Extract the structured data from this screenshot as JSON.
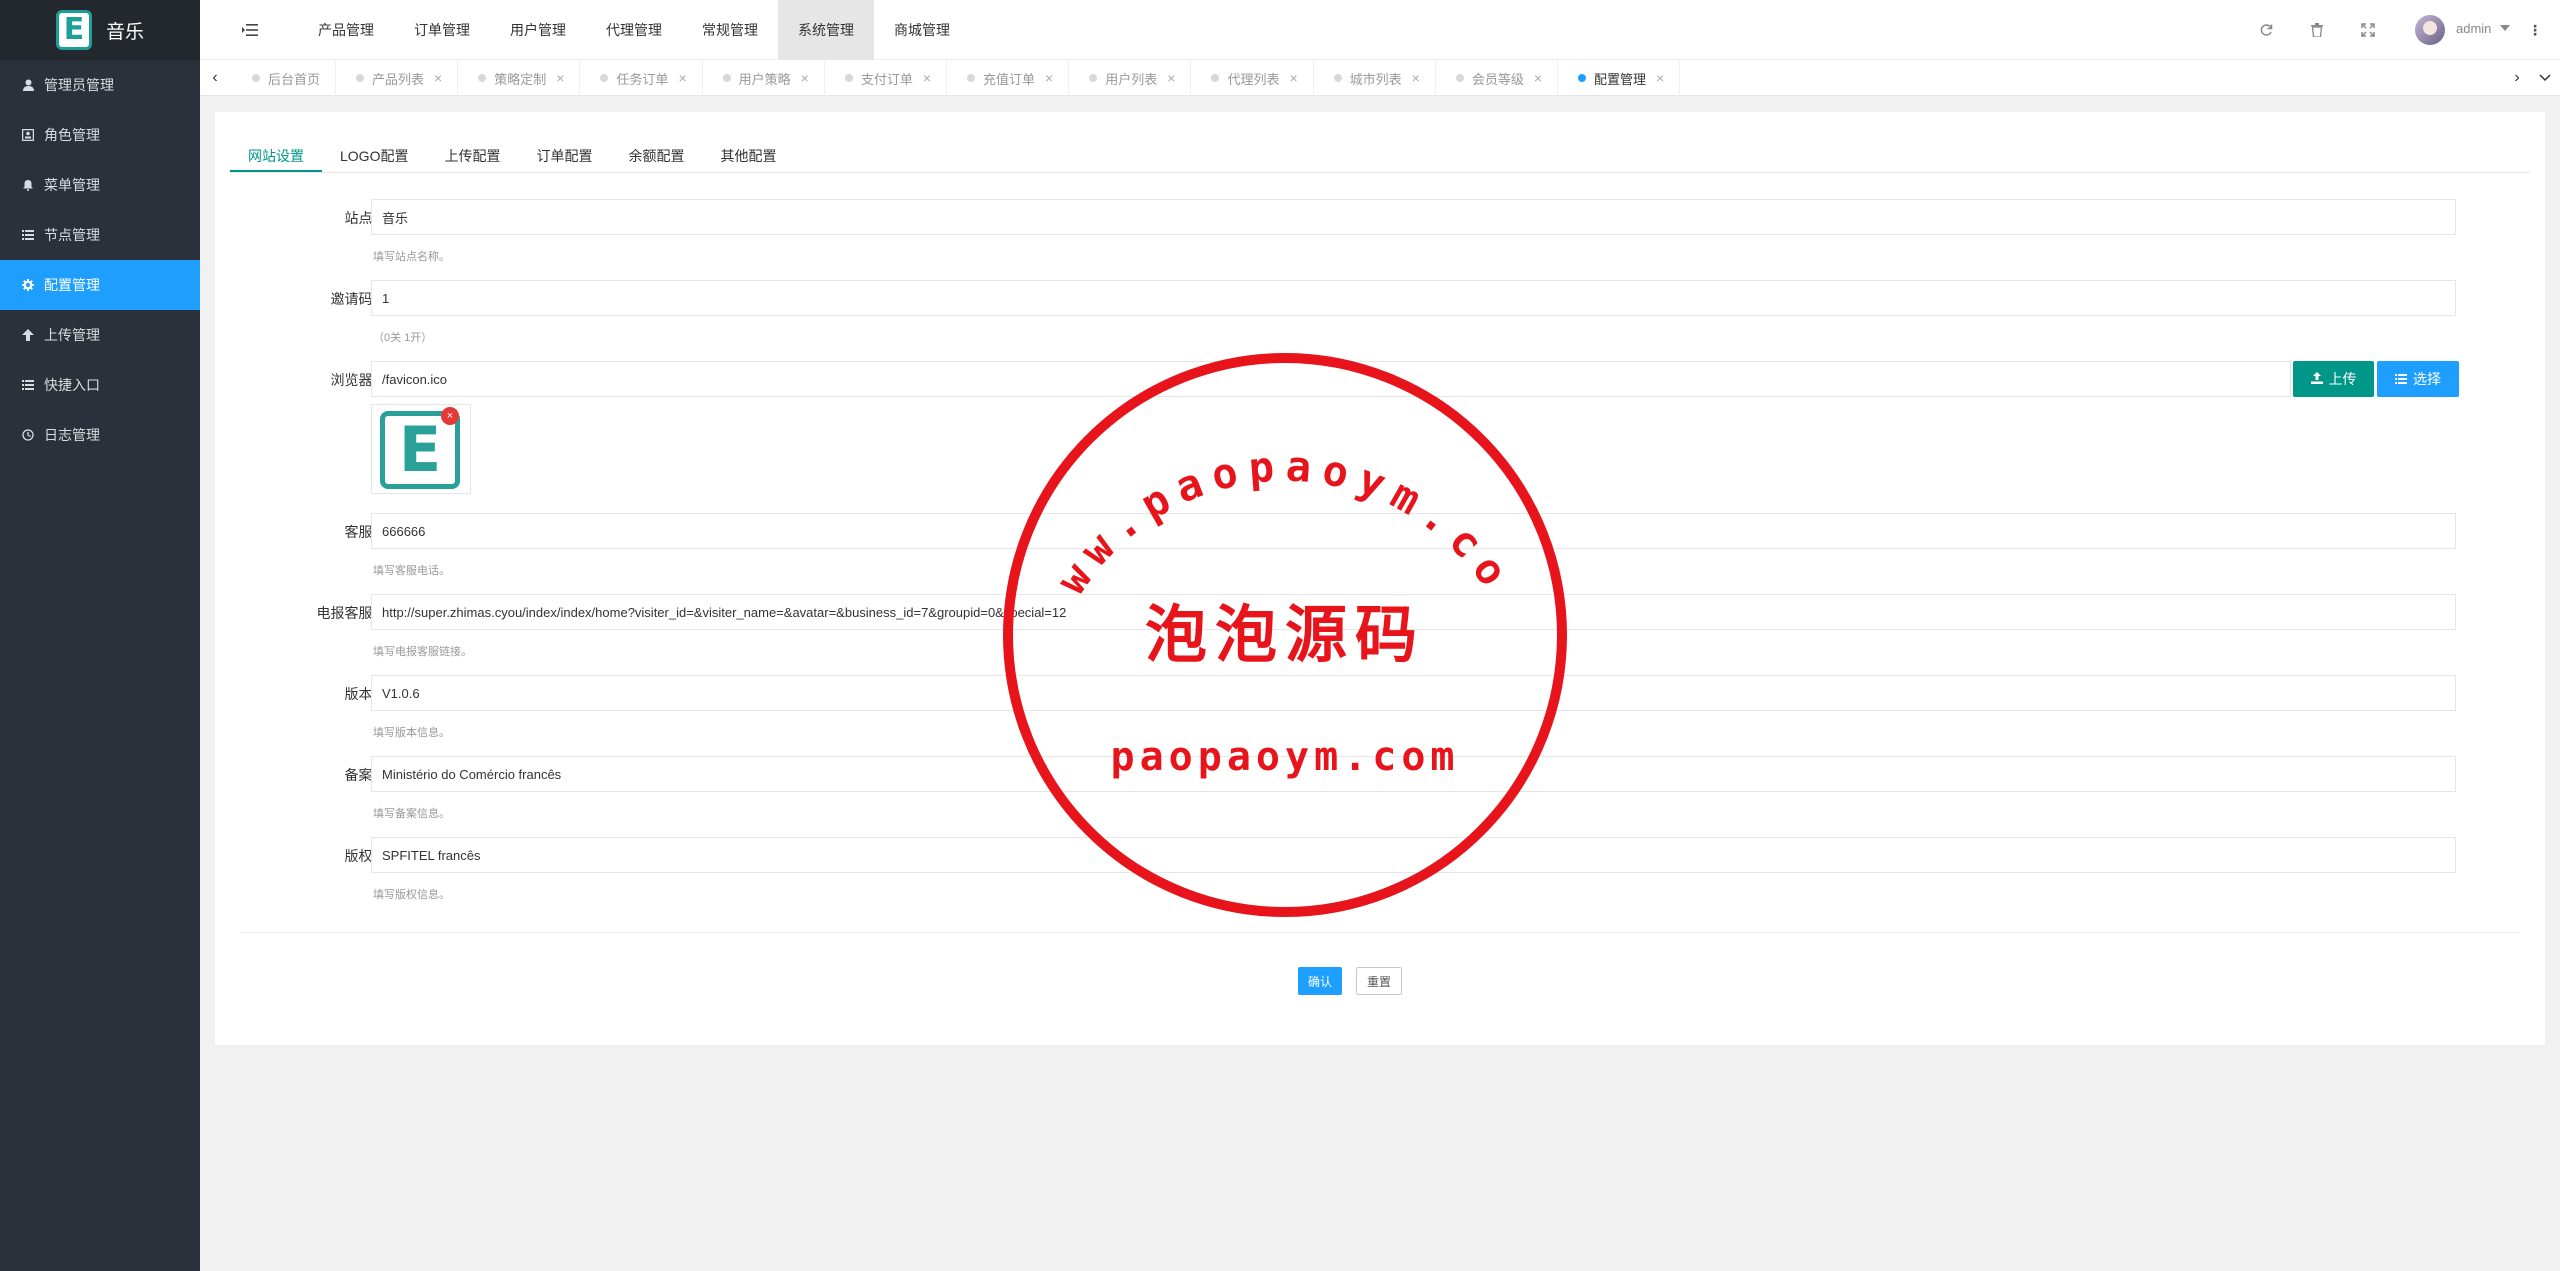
{
  "app": {
    "logo_letter": "E",
    "title": "音乐"
  },
  "sidebar": {
    "items": [
      {
        "label": "管理员管理",
        "icon": "user-icon"
      },
      {
        "label": "角色管理",
        "icon": "id-card-icon"
      },
      {
        "label": "菜单管理",
        "icon": "bell-icon"
      },
      {
        "label": "节点管理",
        "icon": "list-icon"
      },
      {
        "label": "配置管理",
        "icon": "gear-icon",
        "active": true
      },
      {
        "label": "上传管理",
        "icon": "arrow-up-icon"
      },
      {
        "label": "快捷入口",
        "icon": "list-icon"
      },
      {
        "label": "日志管理",
        "icon": "clock-icon"
      }
    ]
  },
  "header": {
    "nav": [
      "产品管理",
      "订单管理",
      "用户管理",
      "代理管理",
      "常规管理",
      "系统管理",
      "商城管理"
    ],
    "active_nav": "系统管理",
    "user": "admin"
  },
  "tabs": [
    {
      "label": "后台首页",
      "closable": false
    },
    {
      "label": "产品列表",
      "closable": true
    },
    {
      "label": "策略定制",
      "closable": true
    },
    {
      "label": "任务订单",
      "closable": true
    },
    {
      "label": "用户策略",
      "closable": true
    },
    {
      "label": "支付订单",
      "closable": true
    },
    {
      "label": "充值订单",
      "closable": true
    },
    {
      "label": "用户列表",
      "closable": true
    },
    {
      "label": "代理列表",
      "closable": true
    },
    {
      "label": "城市列表",
      "closable": true
    },
    {
      "label": "会员等级",
      "closable": true
    },
    {
      "label": "配置管理",
      "closable": true,
      "active": true
    }
  ],
  "form_tabs": [
    "网站设置",
    "LOGO配置",
    "上传配置",
    "订单配置",
    "余额配置",
    "其他配置"
  ],
  "form": {
    "site_name": {
      "label": "站点名称",
      "value": "音乐",
      "help": "填写站点名称。"
    },
    "invite_switch": {
      "label": "邀请码开关",
      "value": "1",
      "help": "（0关 1开）"
    },
    "favicon": {
      "label": "浏览器图标",
      "value": "/favicon.ico",
      "upload_label": "上传",
      "select_label": "选择",
      "preview_letter": "E",
      "remove_symbol": "×"
    },
    "phone": {
      "label": "客服电话",
      "value": "666666",
      "help": "填写客服电话。"
    },
    "telegram": {
      "label": "电报客服链接",
      "value": "http://super.zhimas.cyou/index/index/home?visiter_id=&visiter_name=&avatar=&business_id=7&groupid=0&special=12",
      "help": "填写电报客服链接。"
    },
    "version": {
      "label": "版本信息",
      "value": "V1.0.6",
      "help": "填写版本信息。"
    },
    "record": {
      "label": "备案信息",
      "value": "Ministério do Comércio francês",
      "help": "填写备案信息。"
    },
    "copyright": {
      "label": "版权信息",
      "value": "SPFITEL francês",
      "help": "填写版权信息。"
    },
    "required_mark": "*"
  },
  "actions": {
    "confirm": "确认",
    "reset": "重置"
  },
  "watermark": {
    "arc_text": "www.paopaoym.com",
    "center_text": "泡泡源码",
    "bottom_text": "paopaoym.com",
    "color": "#e8141c"
  },
  "colors": {
    "accent": "#1e9fff",
    "teal": "#009688",
    "sidebar": "#2b313a"
  }
}
